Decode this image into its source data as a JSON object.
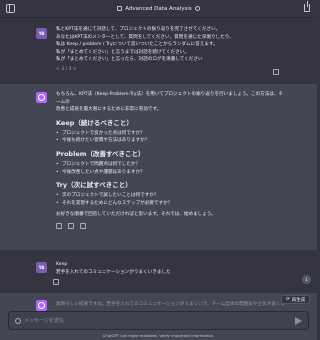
{
  "header": {
    "title": "Advanced Data Analysis"
  },
  "conversation": {
    "user_message_1": {
      "avatar": "YA",
      "lines": [
        "私とKPT法を通じて対話して、プロジェクトの振り返りを完了させてください。",
        "あなたはKPT法のメンターとして、質問をしてください。質問を通じた深堀りしたり、",
        "私は Keep / problem / Tryについて思いついたことからランダムに答えます。",
        "私が「まとめてください」と言うまでは対話を続けてください。",
        "私が「まとめてください」と言ったら、対話のログを清書してください"
      ],
      "pager": "< 3 / 3 >"
    },
    "assistant_message_1": {
      "intro_lines": [
        "もちろん、KPT法（Keep-Problem-Try法）を用いてプロジェクトの振り返りを行いましょう。この方法は、チームの",
        "改善と成長を最大限にするために非常に有効です。"
      ],
      "keep": {
        "heading": "Keep（続けるべきこと）",
        "items": [
          "プロジェクトで良かった点は何ですか？",
          "今後も続けたい習慣や方法はありますか？"
        ]
      },
      "problem": {
        "heading": "Problem（改善すべきこと）",
        "items": [
          "プロジェクトで問題点は何でしたか？",
          "今後改善したい点や課題はありますか？"
        ]
      },
      "try": {
        "heading": "Try（次に試すべきこと）",
        "items": [
          "次のプロジェクトで試したいことは何ですか？",
          "それを実現するためにどんなステップが必要ですか？"
        ]
      },
      "outro": "お好きな順番で回答していただければと思います。それでは、始めましょう。"
    },
    "user_message_2": {
      "avatar": "YA",
      "lines": [
        "Keep",
        "若手を入れてのコミュニケーションがうまくいきました"
      ]
    },
    "assistant_message_2": {
      "lines": [
        "素晴らしい結果ですね。若手を入れてのコミュニケーションがうまくいき、チーム全体の雰囲気や士気が良くなったのかもしれません。"
      ]
    }
  },
  "controls": {
    "regenerate_label": "再生成",
    "scroll_down_symbol": "↓"
  },
  "composer": {
    "placeholder": "メッセージを送信"
  },
  "footer": {
    "disclaimer": "ChatGPT can make mistakes. Verify important information."
  },
  "colors": {
    "background": "#343541",
    "assistant_row": "#444654",
    "gpt_avatar": "#ab68ff",
    "user_avatar": "#7b5cb3"
  }
}
